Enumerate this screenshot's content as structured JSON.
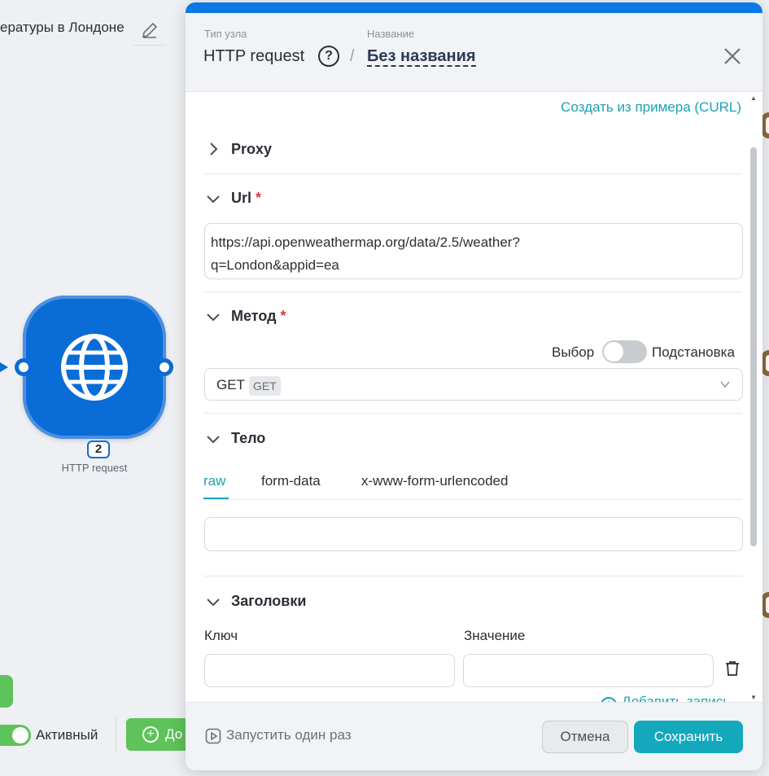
{
  "canvas": {
    "scenario_title": "ературы в Лондоне",
    "node": {
      "number": "2",
      "label": "HTTP request"
    },
    "active_label": "Активный",
    "add_button_label": "До"
  },
  "panel": {
    "header": {
      "type_caption": "Тип узла",
      "type_value": "HTTP request",
      "help_icon": "?",
      "separator": "/",
      "name_caption": "Название",
      "name_value": "Без названия"
    },
    "curl_link": "Создать из примера (CURL)",
    "sections": {
      "proxy": {
        "title": "Proxy",
        "expanded": false
      },
      "url": {
        "title": "Url",
        "required": "*",
        "value_line1": "https://api.openweathermap.org/data/2.5/weather?",
        "value_line2": "q=London&appid=ea"
      },
      "method": {
        "title": "Метод",
        "required": "*",
        "switch_left": "Выбор",
        "switch_right": "Подстановка",
        "switch_on": false,
        "selected": "GET",
        "selected_badge": "GET"
      },
      "body": {
        "title": "Тело",
        "tabs": [
          "raw",
          "form-data",
          "x-www-form-urlencoded"
        ],
        "active_tab": "raw",
        "value": ""
      },
      "headers": {
        "title": "Заголовки",
        "key_label": "Ключ",
        "value_label": "Значение",
        "key_value": "",
        "value_value": "",
        "add_record": "Добавить запись"
      }
    },
    "footer": {
      "run_once": "Запустить один раз",
      "cancel": "Отмена",
      "save": "Сохранить"
    }
  },
  "colors": {
    "accent": "#1ba3b6",
    "node_blue": "#0a6cd6",
    "topbar_blue": "#0b78e3",
    "green": "#5dc35a",
    "required": "#e53935"
  }
}
